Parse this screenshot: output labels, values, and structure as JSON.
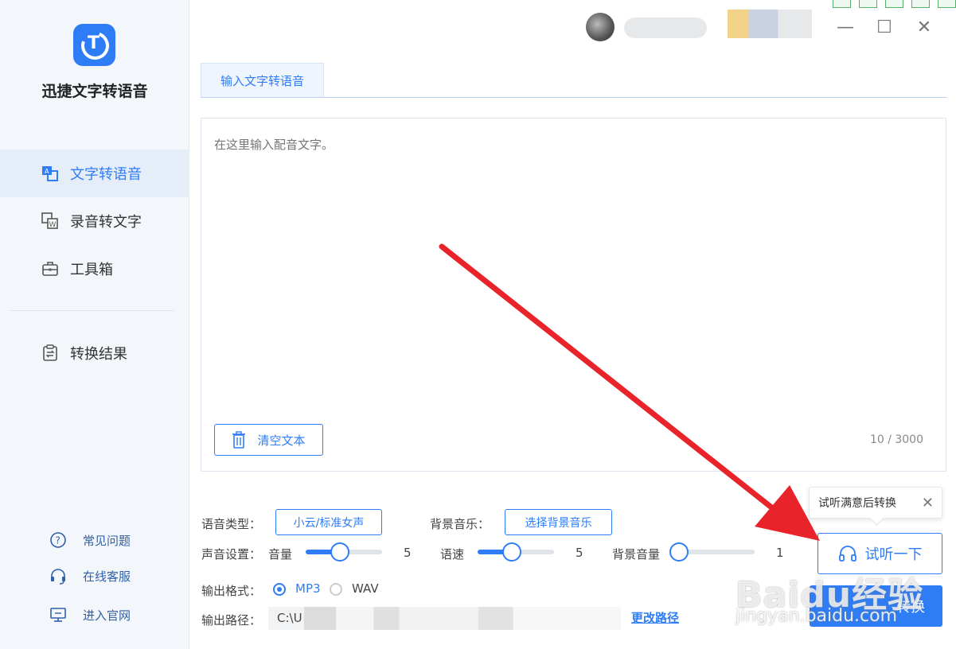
{
  "app": {
    "name": "迅捷文字转语音",
    "logo_letter": "T"
  },
  "sidebar": {
    "items": [
      {
        "label": "文字转语音",
        "icon": "text-to-speech-icon",
        "active": true
      },
      {
        "label": "录音转文字",
        "icon": "audio-to-text-icon",
        "active": false
      },
      {
        "label": "工具箱",
        "icon": "toolbox-icon",
        "active": false
      }
    ],
    "result": {
      "label": "转换结果",
      "icon": "clipboard-icon"
    },
    "footer": [
      {
        "label": "常见问题",
        "icon": "question-icon"
      },
      {
        "label": "在线客服",
        "icon": "headset-icon"
      },
      {
        "label": "进入官网",
        "icon": "monitor-icon"
      }
    ]
  },
  "window": {
    "minimize": "—",
    "maximize": "☐",
    "close": "✕"
  },
  "tabs": [
    {
      "label": "输入文字转语音",
      "active": true
    }
  ],
  "editor": {
    "placeholder": "在这里输入配音文字。",
    "clear_label": "清空文本",
    "count": "10 / 3000"
  },
  "settings": {
    "voice_type_label": "语音类型：",
    "voice_type_value": "小云/标准女声",
    "bgm_label": "背景音乐：",
    "bgm_button": "选择背景音乐",
    "sound_label": "声音设置：",
    "volume_label": "音量",
    "volume_value": "5",
    "volume_fraction": 0.45,
    "speed_label": "语速",
    "speed_value": "5",
    "speed_fraction": 0.45,
    "bg_volume_label": "背景音量",
    "bg_volume_value": "1",
    "bg_volume_fraction": 0.1,
    "format_label": "输出格式：",
    "format_mp3": "MP3",
    "format_wav": "WAV",
    "format_selected": "MP3",
    "path_label": "输出路径：",
    "path_value": "C:\\U",
    "change_path": "更改路径"
  },
  "actions": {
    "tooltip": "试听满意后转换",
    "tooltip_close": "✕",
    "listen": "试听一下",
    "convert": "转换"
  },
  "watermark": {
    "main": "Baidu经验",
    "sub": "jingyan.baidu.com"
  },
  "colors": {
    "accent": "#2f7df6",
    "annotation_arrow": "#e8232a"
  }
}
